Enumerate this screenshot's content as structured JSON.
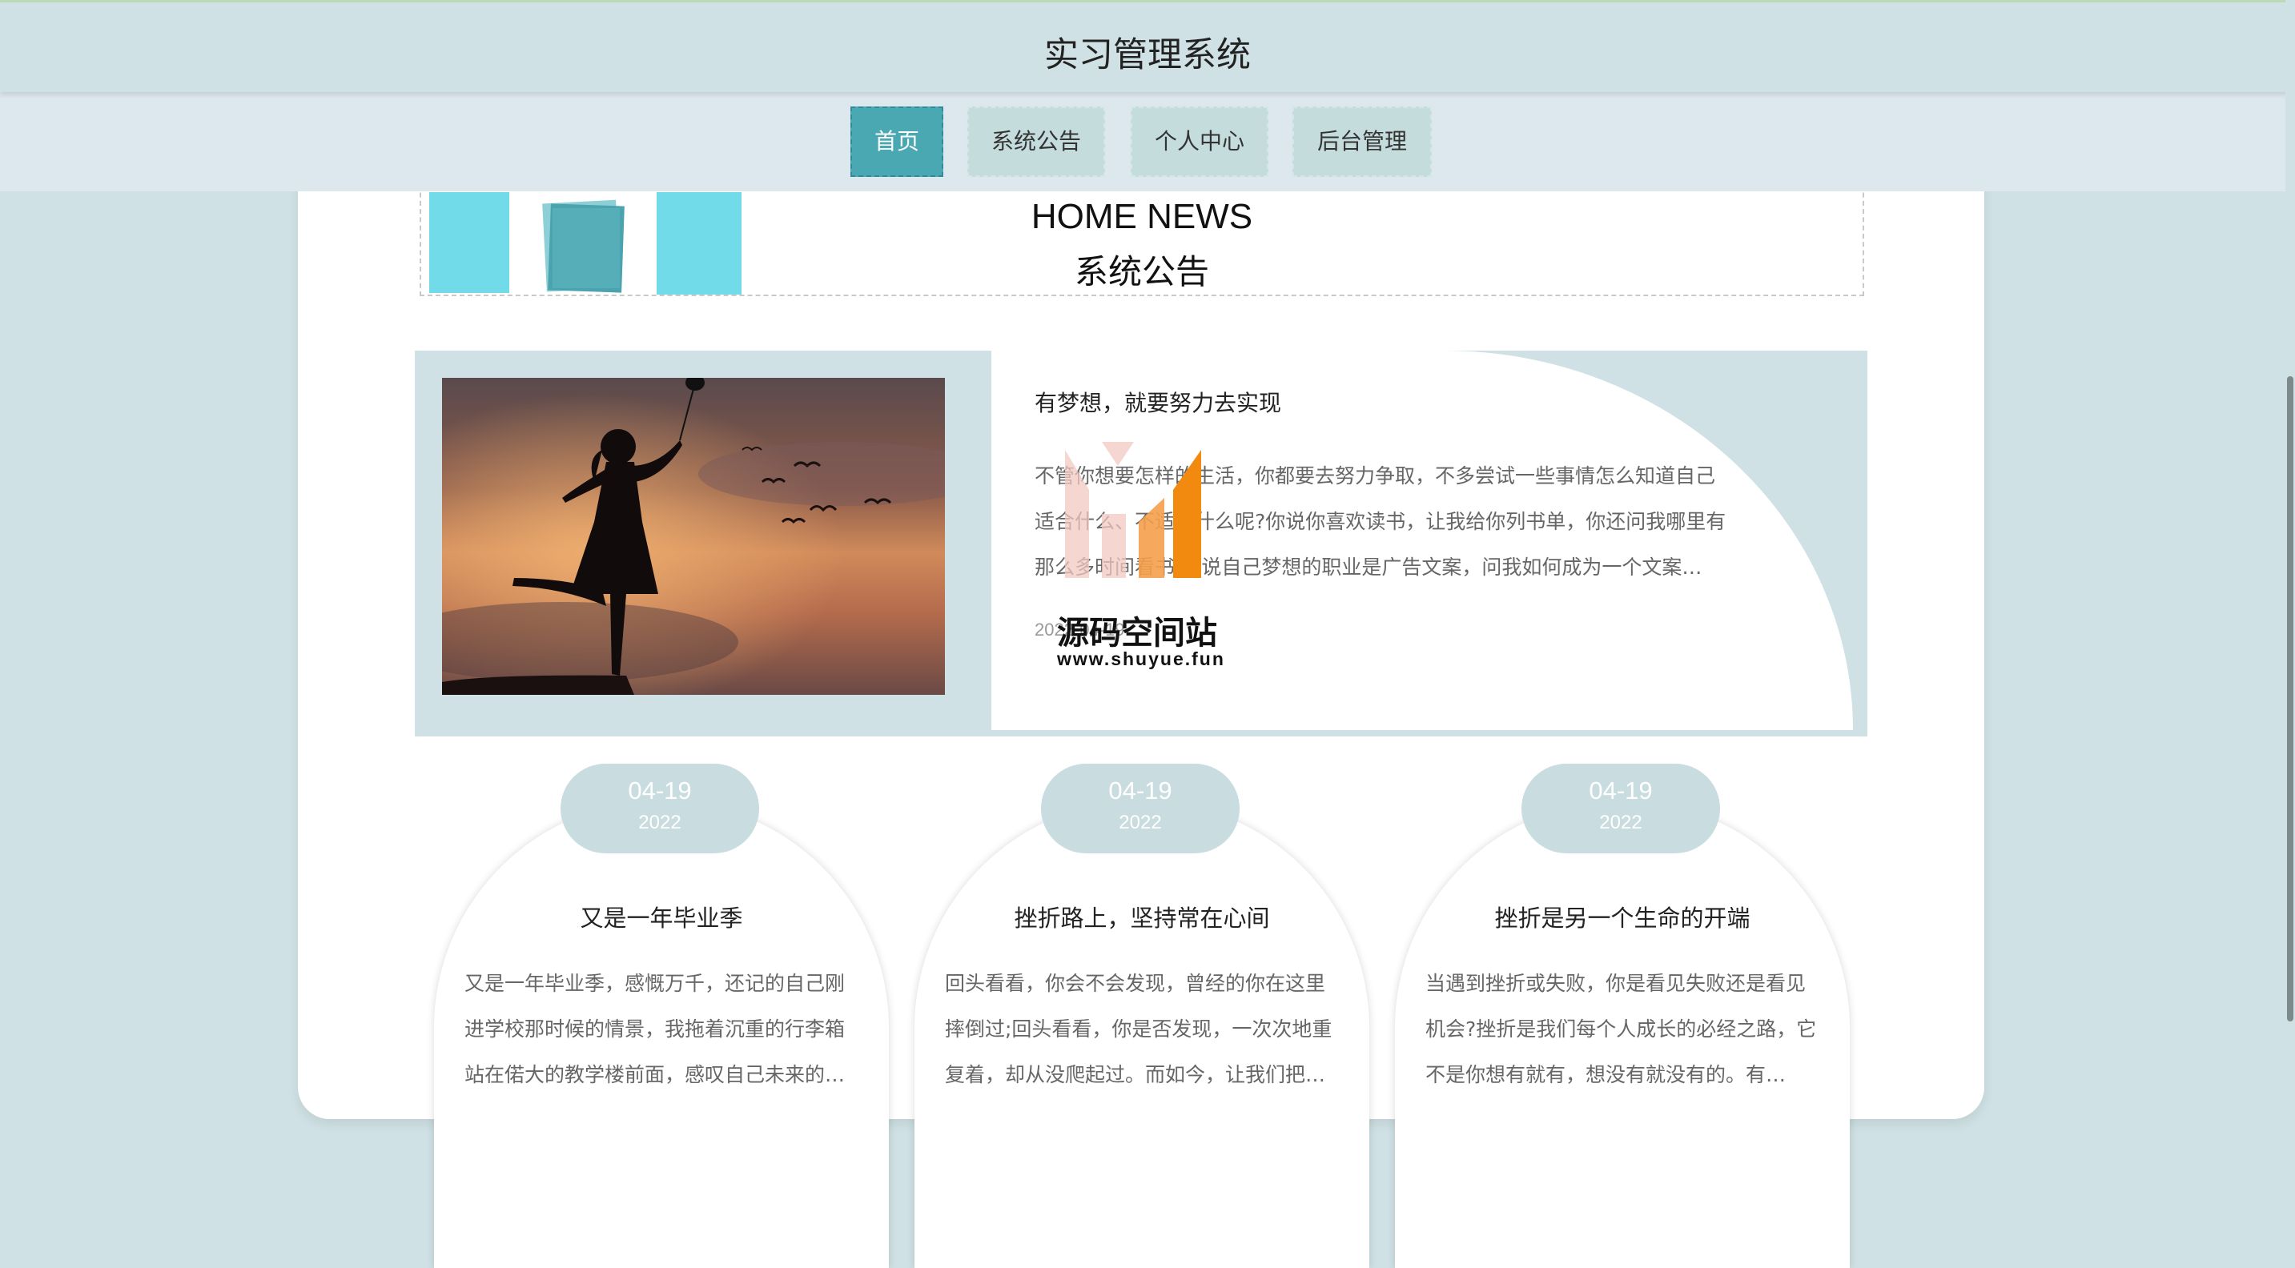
{
  "header": {
    "title": "实习管理系统"
  },
  "nav": {
    "items": [
      {
        "label": "首页",
        "active": true
      },
      {
        "label": "系统公告",
        "active": false
      },
      {
        "label": "个人中心",
        "active": false
      },
      {
        "label": "后台管理",
        "active": false
      }
    ]
  },
  "news_section": {
    "title_en": "HOME NEWS",
    "title_cn": "系统公告"
  },
  "featured": {
    "title": "有梦想，就要努力去实现",
    "body": "不管你想要怎样的生活，你都要去努力争取，不多尝试一些事情怎么知道自己适合什么、不适合什么呢?你说你喜欢读书，让我给你列书单，你还问我哪里有那么多时间看书;你说自己梦想的职业是广告文案，问我如何成为一个文案…",
    "date": "2022-04-19"
  },
  "watermark": {
    "name": "源码空间站",
    "url": "www.shuyue.fun"
  },
  "cards": [
    {
      "date_md": "04-19",
      "date_year": "2022",
      "title": "又是一年毕业季",
      "text": "又是一年毕业季，感慨万千，还记的自己刚进学校那时候的情景，我拖着沉重的行李箱站在偌大的教学楼前面，感叹自己未来的…"
    },
    {
      "date_md": "04-19",
      "date_year": "2022",
      "title": "挫折路上，坚持常在心间",
      "text": "回头看看，你会不会发现，曾经的你在这里摔倒过;回头看看，你是否发现，一次次地重复着，却从没爬起过。而如今，让我们把…"
    },
    {
      "date_md": "04-19",
      "date_year": "2022",
      "title": "挫折是另一个生命的开端",
      "text": "当遇到挫折或失败，你是看见失败还是看见机会?挫折是我们每个人成长的必经之路，它不是你想有就有，想没有就没有的。有…"
    }
  ]
}
